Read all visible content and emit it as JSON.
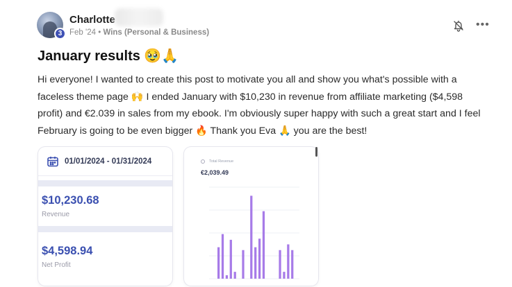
{
  "post": {
    "author_name": "Charlotte",
    "level": "3",
    "date": "Feb '24",
    "separator": "•",
    "category": "Wins (Personal & Business)",
    "title": "January results 🥹🙏",
    "body": "Hi everyone! I wanted to create this post to motivate you all and show you what's possible with a faceless theme page 🙌 I ended January with $10,230 in revenue from affiliate marketing ($4,598 profit) and €2.039 in sales from my ebook. I'm obviously super happy with such a great start and I feel February is going to be even bigger 🔥 Thank you Eva 🙏 you are the best!"
  },
  "icons": {
    "bell": "bell-icon",
    "more": "more-horizontal-icon",
    "calendar": "calendar-icon"
  },
  "stats_card": {
    "date_range": "01/01/2024 - 01/31/2024",
    "revenue_value": "$10,230.68",
    "revenue_label": "Revenue",
    "profit_value": "$4,598.94",
    "profit_label": "Net Profit"
  },
  "revenue_card": {
    "header": "Total Revenue",
    "value": "€2,039.49"
  },
  "colors": {
    "accent": "#3a4fb0",
    "bar": "#a77be8",
    "band": "#e8eaf4"
  },
  "chart_data": {
    "type": "bar",
    "values": [
      55,
      78,
      6,
      68,
      12,
      0,
      50,
      0,
      145,
      55,
      70,
      118,
      0,
      0,
      0,
      50,
      12,
      60,
      50
    ],
    "ylim": [
      0,
      160
    ],
    "grid": true
  }
}
